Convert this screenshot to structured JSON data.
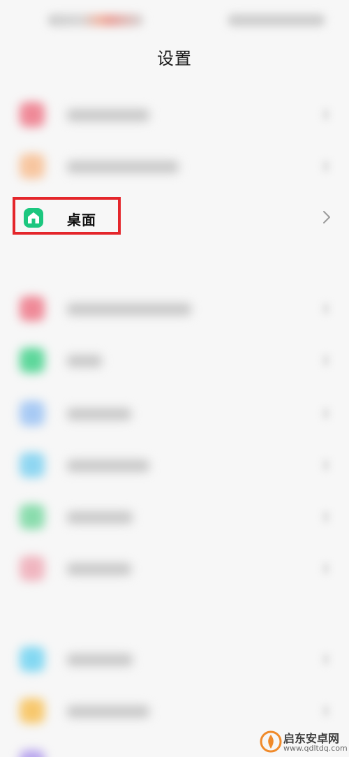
{
  "header": {
    "title": "设置"
  },
  "desktop_row": {
    "label": "桌面",
    "icon": "home-icon",
    "icon_color": "#1cc77f",
    "highlight_color": "#e4262b"
  },
  "watermark": {
    "brand": "启东安卓网",
    "url": "www.qdltdq.com"
  },
  "colors": {
    "background": "#f7f7f7",
    "title_text": "#1a1a1a"
  }
}
